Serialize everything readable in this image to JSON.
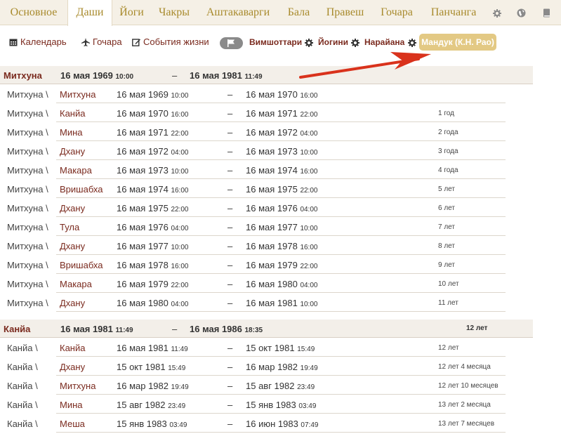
{
  "tabs": [
    {
      "label": "Основное",
      "active": false
    },
    {
      "label": "Даши",
      "active": true
    },
    {
      "label": "Йоги",
      "active": false
    },
    {
      "label": "Чакры",
      "active": false
    },
    {
      "label": "Аштакаварги",
      "active": false
    },
    {
      "label": "Бала",
      "active": false
    },
    {
      "label": "Правеш",
      "active": false
    },
    {
      "label": "Гочара",
      "active": false
    },
    {
      "label": "Панчанга",
      "active": false
    }
  ],
  "tab_icons": [
    "gear-icon",
    "globe-icon",
    "book-icon"
  ],
  "toolbar": {
    "calendar": "Календарь",
    "gochara": "Гочара",
    "life_events": "События жизни",
    "vimshottari": "Вимшоттари",
    "yogini": "Йогини",
    "narayana": "Нарайана",
    "manduk": "Мандук (К.Н. Рао)"
  },
  "colors": {
    "accent": "#a88a2c",
    "link": "#7a2a1e",
    "pill": "#e3c984",
    "arrow": "#d9321c"
  },
  "groups": [
    {
      "name": "Митхуна",
      "start_date": "16 мая 1969",
      "start_time": "10:00",
      "dash": "–",
      "end_date": "16 мая 1981",
      "end_time": "11:49",
      "age": "",
      "rows": [
        {
          "maha": "Митхуна \\",
          "antar": "Митхуна",
          "start": "16 мая 1969",
          "start_time": "10:00",
          "end": "16 мая 1970",
          "end_time": "16:00",
          "age": ""
        },
        {
          "maha": "Митхуна \\",
          "antar": "Канйа",
          "start": "16 мая 1970",
          "start_time": "16:00",
          "end": "16 мая 1971",
          "end_time": "22:00",
          "age": "1 год"
        },
        {
          "maha": "Митхуна \\",
          "antar": "Мина",
          "start": "16 мая 1971",
          "start_time": "22:00",
          "end": "16 мая 1972",
          "end_time": "04:00",
          "age": "2 года"
        },
        {
          "maha": "Митхуна \\",
          "antar": "Дхану",
          "start": "16 мая 1972",
          "start_time": "04:00",
          "end": "16 мая 1973",
          "end_time": "10:00",
          "age": "3 года"
        },
        {
          "maha": "Митхуна \\",
          "antar": "Макара",
          "start": "16 мая 1973",
          "start_time": "10:00",
          "end": "16 мая 1974",
          "end_time": "16:00",
          "age": "4 года"
        },
        {
          "maha": "Митхуна \\",
          "antar": "Вришабха",
          "start": "16 мая 1974",
          "start_time": "16:00",
          "end": "16 мая 1975",
          "end_time": "22:00",
          "age": "5 лет"
        },
        {
          "maha": "Митхуна \\",
          "antar": "Дхану",
          "start": "16 мая 1975",
          "start_time": "22:00",
          "end": "16 мая 1976",
          "end_time": "04:00",
          "age": "6 лет"
        },
        {
          "maha": "Митхуна \\",
          "antar": "Тула",
          "start": "16 мая 1976",
          "start_time": "04:00",
          "end": "16 мая 1977",
          "end_time": "10:00",
          "age": "7 лет"
        },
        {
          "maha": "Митхуна \\",
          "antar": "Дхану",
          "start": "16 мая 1977",
          "start_time": "10:00",
          "end": "16 мая 1978",
          "end_time": "16:00",
          "age": "8 лет"
        },
        {
          "maha": "Митхуна \\",
          "antar": "Вришабха",
          "start": "16 мая 1978",
          "start_time": "16:00",
          "end": "16 мая 1979",
          "end_time": "22:00",
          "age": "9 лет"
        },
        {
          "maha": "Митхуна \\",
          "antar": "Макара",
          "start": "16 мая 1979",
          "start_time": "22:00",
          "end": "16 мая 1980",
          "end_time": "04:00",
          "age": "10 лет"
        },
        {
          "maha": "Митхуна \\",
          "antar": "Дхану",
          "start": "16 мая 1980",
          "start_time": "04:00",
          "end": "16 мая 1981",
          "end_time": "10:00",
          "age": "11 лет"
        }
      ]
    },
    {
      "name": "Канйа",
      "start_date": "16 мая 1981",
      "start_time": "11:49",
      "dash": "–",
      "end_date": "16 мая 1986",
      "end_time": "18:35",
      "age": "12 лет",
      "rows": [
        {
          "maha": "Канйа \\",
          "antar": "Канйа",
          "start": "16 мая 1981",
          "start_time": "11:49",
          "end": "15 окт 1981",
          "end_time": "15:49",
          "age": "12 лет"
        },
        {
          "maha": "Канйа \\",
          "antar": "Дхану",
          "start": "15 окт 1981",
          "start_time": "15:49",
          "end": "16 мар 1982",
          "end_time": "19:49",
          "age": "12 лет 4 месяца"
        },
        {
          "maha": "Канйа \\",
          "antar": "Митхуна",
          "start": "16 мар 1982",
          "start_time": "19:49",
          "end": "15 авг 1982",
          "end_time": "23:49",
          "age": "12 лет 10 месяцев"
        },
        {
          "maha": "Канйа \\",
          "antar": "Мина",
          "start": "15 авг 1982",
          "start_time": "23:49",
          "end": "15 янв 1983",
          "end_time": "03:49",
          "age": "13 лет 2 месяца"
        },
        {
          "maha": "Канйа \\",
          "antar": "Меша",
          "start": "15 янв 1983",
          "start_time": "03:49",
          "end": "16 июн 1983",
          "end_time": "07:49",
          "age": "13 лет 7 месяцев"
        }
      ]
    }
  ]
}
